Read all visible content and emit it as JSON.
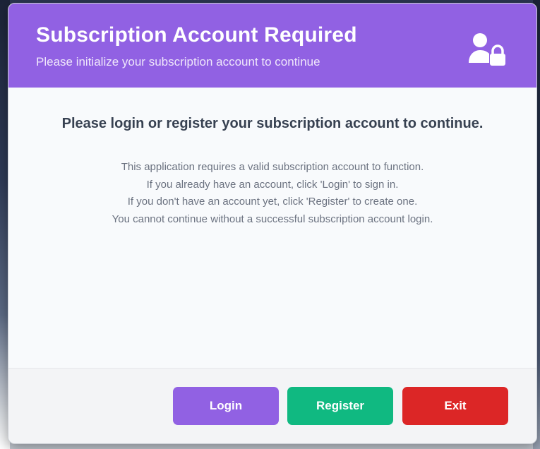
{
  "dialog": {
    "title": "Subscription Account Required",
    "subtitle": "Please initialize your subscription account to continue",
    "icon": "user-lock-icon",
    "heading": "Please login or register your subscription account to continue.",
    "description": [
      "This application requires a valid subscription account to function.",
      "If you already have an account, click 'Login' to sign in.",
      "If you don't have an account yet, click 'Register' to create one.",
      "You cannot continue without a successful subscription account login."
    ]
  },
  "buttons": {
    "login": "Login",
    "register": "Register",
    "exit": "Exit"
  },
  "colors": {
    "header": "#9161e3",
    "login": "#9161e3",
    "register": "#10b981",
    "exit": "#dc2626"
  }
}
